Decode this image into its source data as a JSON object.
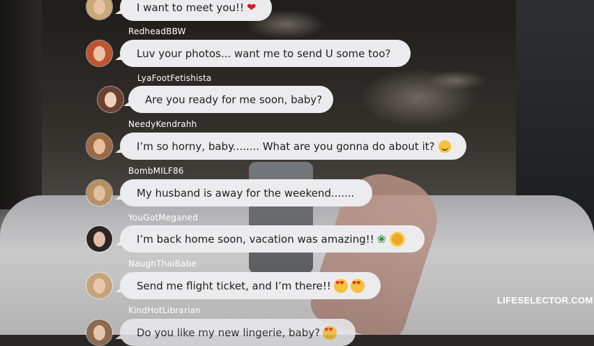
{
  "messages": [
    {
      "username": "",
      "text": "I want to meet you!!",
      "emoji": "heart-emoji"
    },
    {
      "username": "RedheadBBW",
      "text": "Luv your photos... want me to send U some too?",
      "emoji": ""
    },
    {
      "username": "LyaFootFetishista",
      "text": "Are you ready for me soon, baby?",
      "emoji": ""
    },
    {
      "username": "NeedyKendrahh",
      "text": "I’m so horny, baby........ What are you gonna do about it?",
      "emoji": "smiling-face-emoji"
    },
    {
      "username": "BombMILF86",
      "text": "My husband is away for the weekend.......",
      "emoji": ""
    },
    {
      "username": "YouGotMeganed",
      "text": "I’m back home soon, vacation was amazing!!",
      "emoji": "palm-sun-emoji"
    },
    {
      "username": "NaughThaiBabe",
      "text": "Send me flight ticket, and I’m there!!",
      "emoji": "in-love-face-emoji"
    },
    {
      "username": "KindHotLibrarian",
      "text": "Do you like my new lingerie, baby?",
      "emoji": "in-love-face-emoji"
    }
  ],
  "watermark": "LIFESELECTOR.COM",
  "colors": {
    "bubble": "#ececee",
    "username": "#ffffff",
    "text": "#1e1e1e"
  }
}
